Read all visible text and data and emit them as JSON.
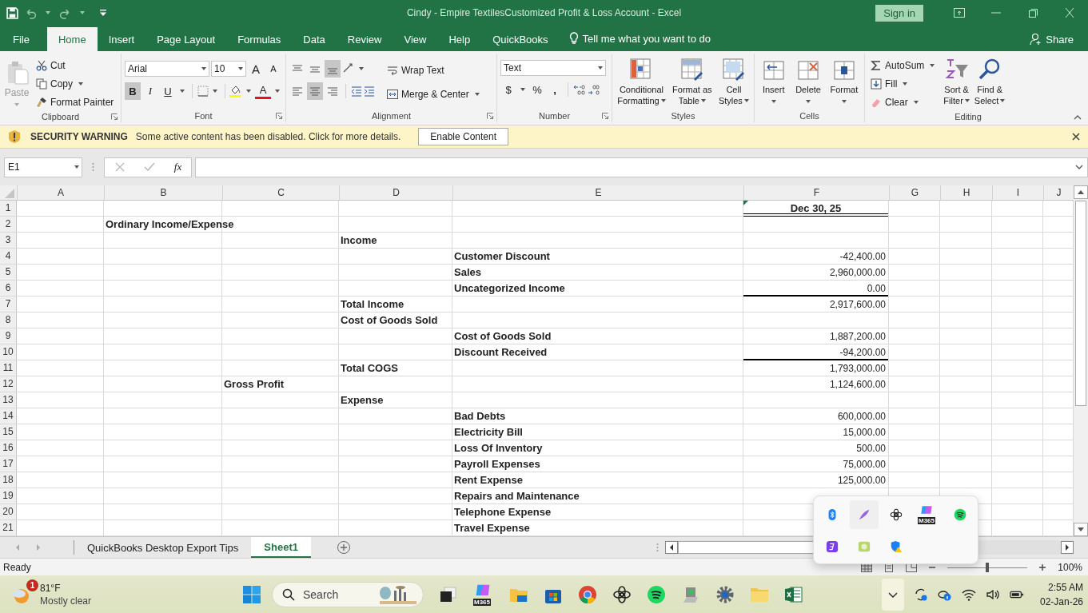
{
  "title_bar": {
    "title": "Cindy - Empire TextilesCustomized Profit & Loss Account  -  Excel",
    "sign_in": "Sign in"
  },
  "menu": {
    "tabs": [
      {
        "label": "File",
        "selected": false
      },
      {
        "label": "Home",
        "selected": true
      },
      {
        "label": "Insert",
        "selected": false
      },
      {
        "label": "Page Layout",
        "selected": false
      },
      {
        "label": "Formulas",
        "selected": false
      },
      {
        "label": "Data",
        "selected": false
      },
      {
        "label": "Review",
        "selected": false
      },
      {
        "label": "View",
        "selected": false
      },
      {
        "label": "Help",
        "selected": false
      },
      {
        "label": "QuickBooks",
        "selected": false
      }
    ],
    "tell_me": "Tell me what you want to do",
    "share": "Share"
  },
  "ribbon": {
    "clipboard": {
      "label": "Clipboard",
      "paste": "Paste",
      "cut": "Cut",
      "copy": "Copy",
      "format_painter": "Format Painter"
    },
    "font": {
      "label": "Font",
      "name": "Arial",
      "size": "10",
      "grow": "A",
      "shrink": "A",
      "bold": {
        "text": "B",
        "on": true
      },
      "italic": {
        "text": "I",
        "on": false
      },
      "underline": {
        "text": "U",
        "on": false
      },
      "color_letter": "A"
    },
    "alignment": {
      "label": "Alignment",
      "wrap_text": "Wrap Text",
      "merge_center": "Merge & Center",
      "vertical": [
        {
          "selected": false
        },
        {
          "selected": false
        },
        {
          "selected": true
        }
      ],
      "horizontal": [
        {
          "selected": false
        },
        {
          "selected": true
        },
        {
          "selected": false
        }
      ]
    },
    "number": {
      "label": "Number",
      "format": "Text",
      "currency": "$",
      "percent": "%",
      "comma": ","
    },
    "styles": {
      "label": "Styles",
      "buttons": [
        {
          "line1": "Conditional",
          "line2": "Formatting"
        },
        {
          "line1": "Format as",
          "line2": "Table"
        },
        {
          "line1": "Cell",
          "line2": "Styles"
        }
      ]
    },
    "cells": {
      "label": "Cells",
      "buttons": [
        "Insert",
        "Delete",
        "Format"
      ]
    },
    "editing": {
      "label": "Editing",
      "autosum": "AutoSum",
      "fill": "Fill",
      "clear": "Clear",
      "sort_filter": {
        "line1": "Sort &",
        "line2": "Filter"
      },
      "find_select": {
        "line1": "Find &",
        "line2": "Select"
      }
    }
  },
  "security_bar": {
    "title": "SECURITY WARNING",
    "message": "Some active content has been disabled. Click for more details.",
    "button": "Enable Content"
  },
  "formula_bar": {
    "name_box": "E1",
    "fx": "fx"
  },
  "grid": {
    "columns": [
      "A",
      "B",
      "C",
      "D",
      "E",
      "F",
      "G",
      "H",
      "I",
      "J"
    ],
    "rows": [
      {
        "n": "1",
        "kind": "header",
        "f": "Dec 30, 25",
        "double_rule": true,
        "error_mark": true
      },
      {
        "n": "2",
        "b": "Ordinary Income/Expense"
      },
      {
        "n": "3",
        "d": "Income"
      },
      {
        "n": "4",
        "e": "Customer Discount",
        "f": "-42,400.00"
      },
      {
        "n": "5",
        "e": "Sales",
        "f": "2,960,000.00"
      },
      {
        "n": "6",
        "e": "Uncategorized Income",
        "f": "0.00",
        "single_rule": true
      },
      {
        "n": "7",
        "d": "Total Income",
        "f": "2,917,600.00"
      },
      {
        "n": "8",
        "d": "Cost of Goods Sold"
      },
      {
        "n": "9",
        "e": "Cost of Goods Sold",
        "f": "1,887,200.00"
      },
      {
        "n": "10",
        "e": "Discount Received",
        "f": "-94,200.00",
        "single_rule": true
      },
      {
        "n": "11",
        "d": "Total COGS",
        "f": "1,793,000.00"
      },
      {
        "n": "12",
        "c": "Gross Profit",
        "f": "1,124,600.00"
      },
      {
        "n": "13",
        "d": "Expense"
      },
      {
        "n": "14",
        "e": "Bad Debts",
        "f": "600,000.00"
      },
      {
        "n": "15",
        "e": "Electricity Bill",
        "f": "15,000.00"
      },
      {
        "n": "16",
        "e": "Loss Of Inventory",
        "f": "500.00"
      },
      {
        "n": "17",
        "e": "Payroll Expenses",
        "f": "75,000.00"
      },
      {
        "n": "18",
        "e": "Rent Expense",
        "f": "125,000.00"
      },
      {
        "n": "19",
        "e": "Repairs and Maintenance"
      },
      {
        "n": "20",
        "e": "Telephone Expense"
      },
      {
        "n": "21",
        "e": "Travel Expense"
      }
    ]
  },
  "sheet_tabs": [
    {
      "label": "QuickBooks Desktop Export Tips",
      "selected": false
    },
    {
      "label": "Sheet1",
      "selected": true
    }
  ],
  "status_bar": {
    "status": "Ready",
    "zoom": "100%",
    "zoom_slider": {
      "level": 0.5
    }
  },
  "taskbar": {
    "weather": {
      "badge": "1",
      "temperature": "81°F",
      "condition": "Mostly clear"
    },
    "search": {
      "placeholder": "Search"
    },
    "copilot_badge": "M365",
    "time": "2:55 AM",
    "date": "02-Jan-26"
  },
  "tray_popup": {
    "copilot_badge": "M365"
  }
}
